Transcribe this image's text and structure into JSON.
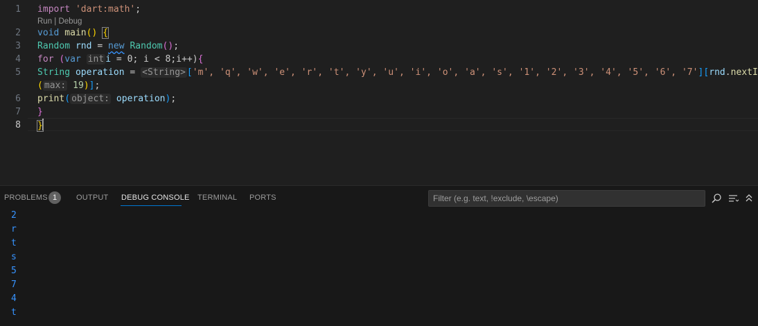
{
  "editor": {
    "line_numbers": [
      "1",
      "2",
      "3",
      "4",
      "5",
      "",
      "6",
      "7",
      "8"
    ],
    "codelens": "Run | Debug",
    "lines": {
      "l1": {
        "import": "import",
        "str": "'dart:math'",
        "semi": ";"
      },
      "l2": {
        "void": "void",
        "main": "main",
        "paren": "()",
        "brace": "{"
      },
      "l3": {
        "type": "Random",
        "name": "rnd",
        "eq": " = ",
        "new": "new",
        "sp": " ",
        "ctor": "Random",
        "paren": "()",
        "semi": ";"
      },
      "l4": {
        "for": "for",
        "open": " (",
        "var": "var",
        "hint": "int",
        "i": "i",
        "rest": " = 0; i < 8;i++)",
        "brace": "{"
      },
      "l5": {
        "type": "String",
        "name": "operation",
        "eq": " = ",
        "hint": "<String>",
        "open": "[",
        "items": "'m', 'q', 'w', 'e', 'r', 't', 'y', 'u', 'i', 'o', 'a', 's', '1', '2', '3', '4', '5', '6', '7'",
        "close": "]",
        "idxopen": "[",
        "rnd": "rnd",
        "dot": ".",
        "method": "nextInt"
      },
      "l5b": {
        "paren": "(",
        "hint": "max:",
        "num": "19",
        "close": ")",
        "bracket": "]",
        "semi": ";"
      },
      "l6": {
        "fn": "print",
        "open": "(",
        "hint": "object:",
        "arg": "operation",
        "close": ")",
        "semi": ";"
      },
      "l7": {
        "brace": "}"
      },
      "l8": {
        "brace": "}"
      }
    }
  },
  "panel": {
    "tabs": [
      {
        "label": "PROBLEMS"
      },
      {
        "label": "OUTPUT"
      },
      {
        "label": "DEBUG CONSOLE"
      },
      {
        "label": "TERMINAL"
      },
      {
        "label": "PORTS"
      }
    ],
    "problems_count": "1",
    "active_tab": "DEBUG CONSOLE",
    "filter_placeholder": "Filter (e.g. text, !exclude, \\escape)",
    "icons": [
      "search-icon",
      "word-wrap-icon",
      "collapse-icon"
    ],
    "output": [
      "2",
      "r",
      "t",
      "s",
      "5",
      "7",
      "4",
      "t"
    ]
  },
  "colors": {
    "keyword": "#569cd6",
    "control": "#c586c0",
    "type": "#4ec9b0",
    "function": "#dcdcaa",
    "variable": "#9cdcfe",
    "string": "#ce9178",
    "number": "#b5cea8",
    "console_output": "#3794ff",
    "active_tab_underline": "#0078d4"
  }
}
